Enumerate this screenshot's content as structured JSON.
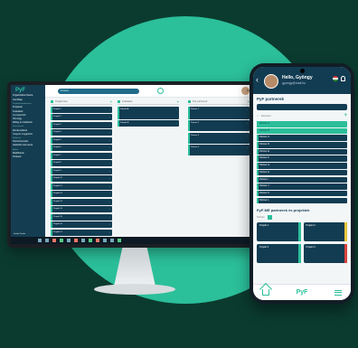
{
  "monitor": {
    "sidebar": {
      "logo": "PyF",
      "org": "Organization Name",
      "items": [
        {
          "label": "Kezdőlap"
        },
        {
          "label": "Projektmenedzsment",
          "section": true
        },
        {
          "label": "Projektek"
        },
        {
          "label": "Feladatok"
        },
        {
          "label": "Új csoportok"
        },
        {
          "label": "Pénzügy"
        },
        {
          "label": "Előleg és kiadások"
        },
        {
          "label": "Kimutatások",
          "section": true
        },
        {
          "label": "Elszámolások"
        },
        {
          "label": "Csoport megjelenít."
        },
        {
          "label": "Erőforrás",
          "section": true
        },
        {
          "label": "Partnerkezelés"
        },
        {
          "label": "Határidő szervezés"
        },
        {
          "label": "Admin",
          "section": true
        },
        {
          "label": "Beállítások"
        },
        {
          "label": "Kiírások"
        }
      ],
      "footer_user": "Szabó Tamás"
    },
    "top": {
      "search_placeholder": "Keresés",
      "user_name": "Felhasználó"
    },
    "columns": [
      {
        "title": "Projekt lista",
        "cards": [
          "Projekt 1",
          "Projekt 2",
          "Projekt 3",
          "Projekt 4",
          "Projekt 5",
          "Projekt 6",
          "Projekt 7",
          "Projekt 8",
          "Projekt 9",
          "Projekt 10",
          "Projekt 11",
          "Projekt 12",
          "Projekt 13",
          "Projekt 14",
          "Projekt 15",
          "Projekt 16",
          "Projekt 17"
        ]
      },
      {
        "title": "Feladatok",
        "cards": [
          "Feladat A",
          "Feladat B"
        ]
      },
      {
        "title": "PyF partnerek",
        "cards": [
          "Partner 1",
          "Partner 2",
          "Partner 3",
          "Partner 4"
        ]
      }
    ]
  },
  "phone": {
    "user_name": "Hello, Gyöngy",
    "user_email": "gyongy@mail.hu",
    "title": "PyF partnerek",
    "search_placeholder": "Keresés",
    "rows": [
      "Partner A",
      "Partner B",
      "Partner C",
      "Partner D",
      "Partner E",
      "Partner F",
      "Partner G",
      "Partner H",
      "Partner I",
      "Partner J",
      "Partner K",
      "Partner L"
    ],
    "subtitle": "PyF-ME partnerek és projektek",
    "filter_label": "Szűrés",
    "tiles": [
      {
        "label": "Projekt 1",
        "color": "#2bbf9a"
      },
      {
        "label": "Projekt 2",
        "color": "#e7c53a"
      },
      {
        "label": "Projekt 3",
        "color": "#2bbf9a"
      },
      {
        "label": "Projekt 4",
        "color": "#d9443e"
      }
    ],
    "nav_logo": "PyF",
    "accent": "#2bbf9a",
    "navy": "#123c52"
  }
}
